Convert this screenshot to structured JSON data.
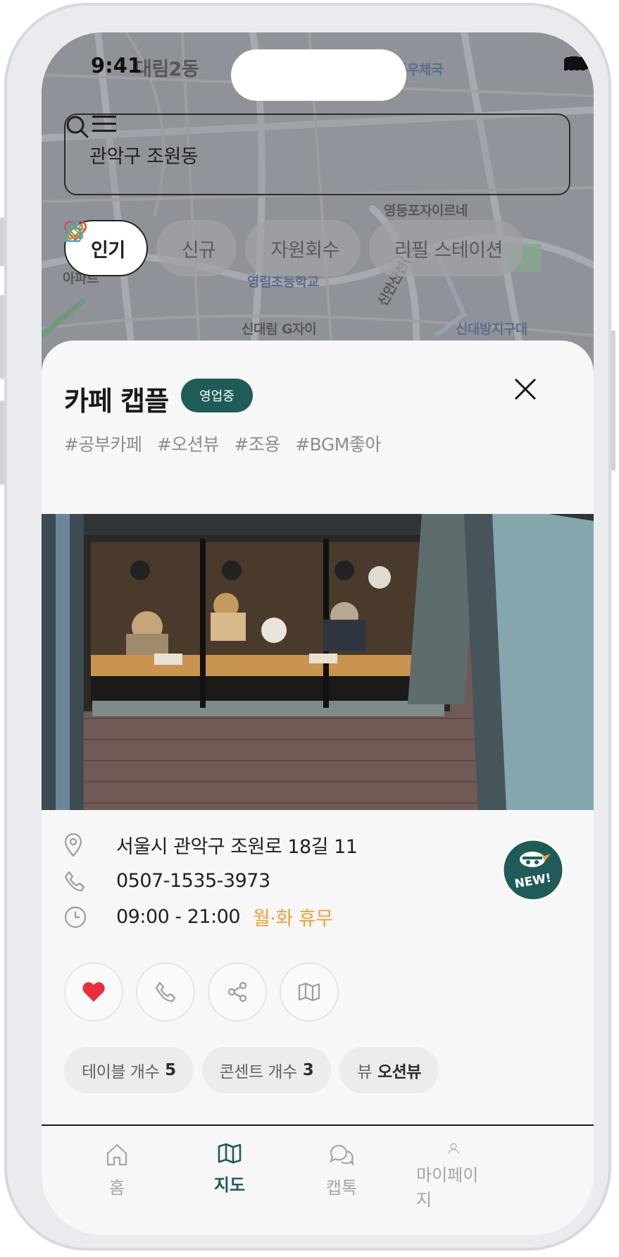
{
  "status": {
    "time": "9:41"
  },
  "search": {
    "text": "관악구 조원동"
  },
  "map": {
    "labels": [
      "대림2동",
      "대림동우체국",
      "영등포자이르네",
      "영림초등학교",
      "아파트",
      "신대림 G자이",
      "신대방지구대",
      "신안산선(공"
    ]
  },
  "chips": [
    {
      "label": "인기",
      "icon": "heart-icon",
      "active": true
    },
    {
      "label": "신규",
      "icon": "party-popper-icon",
      "active": false
    },
    {
      "label": "자원회수",
      "icon": "recycle-atom-icon",
      "active": false
    },
    {
      "label": "리필 스테이션",
      "icon": "refill-bottle-icon",
      "active": false
    }
  ],
  "place": {
    "name": "카페 캡플",
    "status_badge": "영업중",
    "tags": [
      "#공부카페",
      "#오션뷰",
      "#조용",
      "#BGM좋아"
    ],
    "address": "서울시 관악구 조원로 18길 11",
    "phone": "0507-1535-3973",
    "hours": "09:00 - 21:00",
    "closed_days": "월·화 휴무",
    "new_badge": "NEW!"
  },
  "action_buttons": [
    "heart-icon",
    "phone-icon",
    "share-icon",
    "map-icon"
  ],
  "facilities": [
    {
      "label": "테이블 개수",
      "value": "5"
    },
    {
      "label": "콘센트 개수",
      "value": "3"
    },
    {
      "label": "뷰",
      "value": "오션뷰"
    }
  ],
  "tabs": [
    {
      "label": "홈",
      "icon": "home-icon",
      "active": false
    },
    {
      "label": "지도",
      "icon": "map-icon",
      "active": true
    },
    {
      "label": "캡톡",
      "icon": "chat-icon",
      "active": false
    },
    {
      "label": "마이페이지",
      "icon": "user-icon",
      "active": false
    }
  ],
  "colors": {
    "accent": "#1f5b58",
    "closed": "#f1a032",
    "favorite": "#e8303d"
  }
}
